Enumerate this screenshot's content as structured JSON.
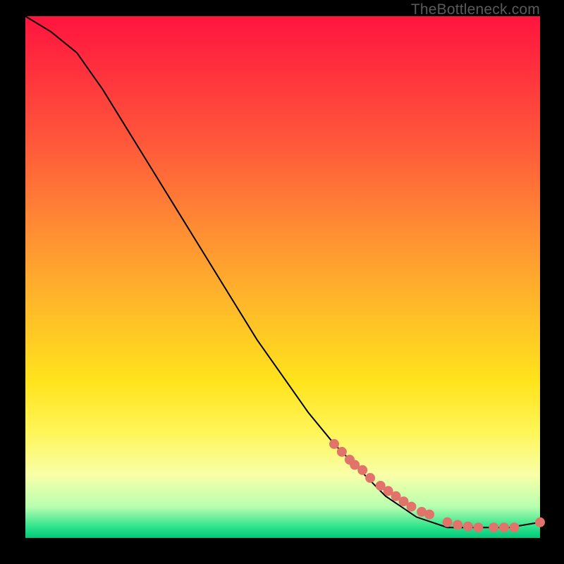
{
  "watermark": "TheBottleneck.com",
  "chart_data": {
    "type": "line",
    "title": "",
    "xlabel": "",
    "ylabel": "",
    "xlim": [
      0,
      100
    ],
    "ylim": [
      0,
      100
    ],
    "series": [
      {
        "name": "curve",
        "x": [
          0,
          5,
          10,
          15,
          20,
          25,
          30,
          35,
          40,
          45,
          50,
          55,
          60,
          65,
          70,
          73,
          76,
          79,
          82,
          85,
          88,
          91,
          94,
          97,
          100
        ],
        "y": [
          100,
          97,
          93,
          86,
          78,
          70,
          62,
          54,
          46,
          38,
          31,
          24,
          18,
          13,
          8,
          6,
          4,
          3,
          2,
          2,
          2,
          2,
          2,
          2.5,
          3
        ]
      }
    ],
    "points": {
      "name": "dots",
      "x": [
        60,
        61.5,
        63,
        64,
        65.5,
        67,
        69,
        70.5,
        72,
        73.5,
        75,
        77,
        78.5,
        82,
        84,
        86,
        88,
        91,
        93,
        95,
        100
      ],
      "y": [
        18,
        16.5,
        15,
        14,
        13,
        11.5,
        10,
        9,
        8,
        7,
        6,
        5,
        4.5,
        3,
        2.5,
        2.2,
        2,
        2,
        2,
        2,
        3
      ]
    },
    "colors": {
      "curve": "#000000",
      "dots": "#e2736b",
      "gradient_top": "#ff143e",
      "gradient_mid": "#ffe31c",
      "gradient_bottom": "#00c97a"
    }
  }
}
